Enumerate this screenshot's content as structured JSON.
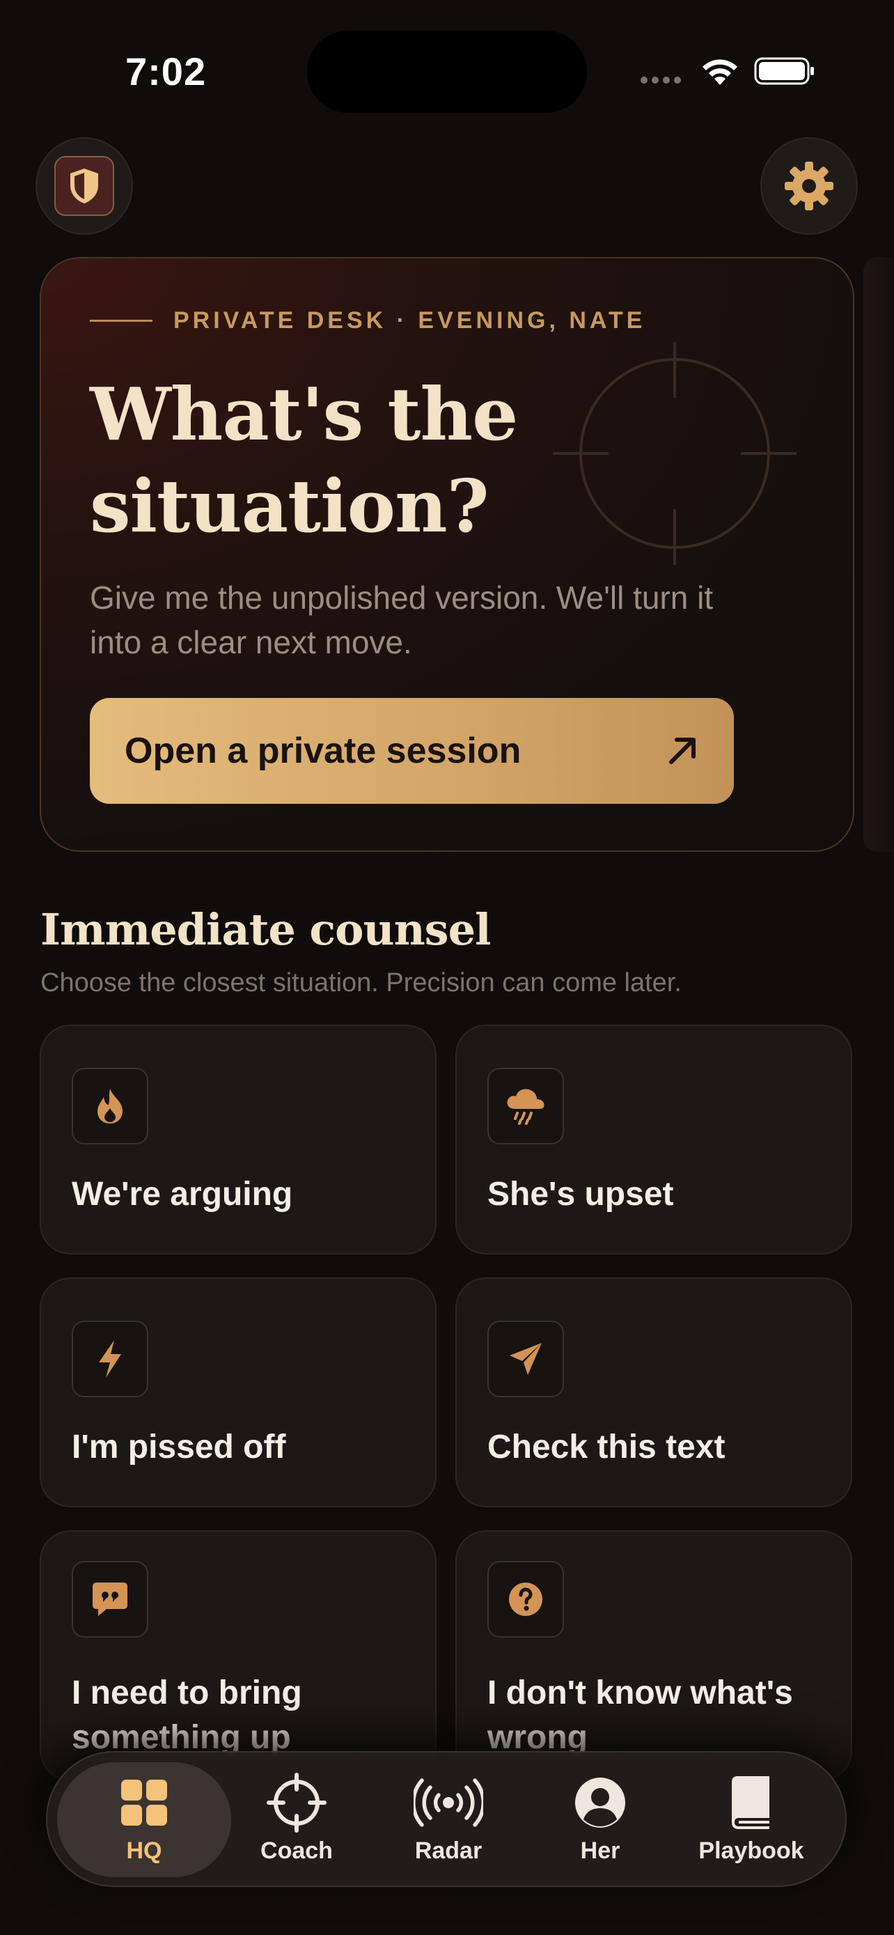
{
  "status_bar": {
    "time": "7:02"
  },
  "hero": {
    "eyebrow": "PRIVATE DESK · EVENING, NATE",
    "title": "What's the situation?",
    "subtitle": "Give me the unpolished version. We'll turn it into a clear next move.",
    "cta_label": "Open a private session"
  },
  "section": {
    "title": "Immediate counsel",
    "subtitle": "Choose the closest situation. Precision can come later."
  },
  "cards": [
    {
      "label": "We're arguing",
      "icon": "flame-icon"
    },
    {
      "label": "She's upset",
      "icon": "rain-cloud-icon"
    },
    {
      "label": "I'm pissed off",
      "icon": "bolt-icon"
    },
    {
      "label": "Check this text",
      "icon": "paper-plane-icon"
    },
    {
      "label": "I need to bring something up",
      "icon": "quote-bubble-icon"
    },
    {
      "label": "I don't know what's wrong",
      "icon": "question-circle-icon"
    }
  ],
  "tabs": [
    {
      "label": "HQ",
      "icon": "grid-icon",
      "active": true
    },
    {
      "label": "Coach",
      "icon": "crosshair-icon"
    },
    {
      "label": "Radar",
      "icon": "broadcast-icon"
    },
    {
      "label": "Her",
      "icon": "person-circle-icon"
    },
    {
      "label": "Playbook",
      "icon": "book-icon"
    }
  ],
  "colors": {
    "accent": "#d9ae6f",
    "background": "#0f0c0b",
    "card": "#1c1816"
  }
}
